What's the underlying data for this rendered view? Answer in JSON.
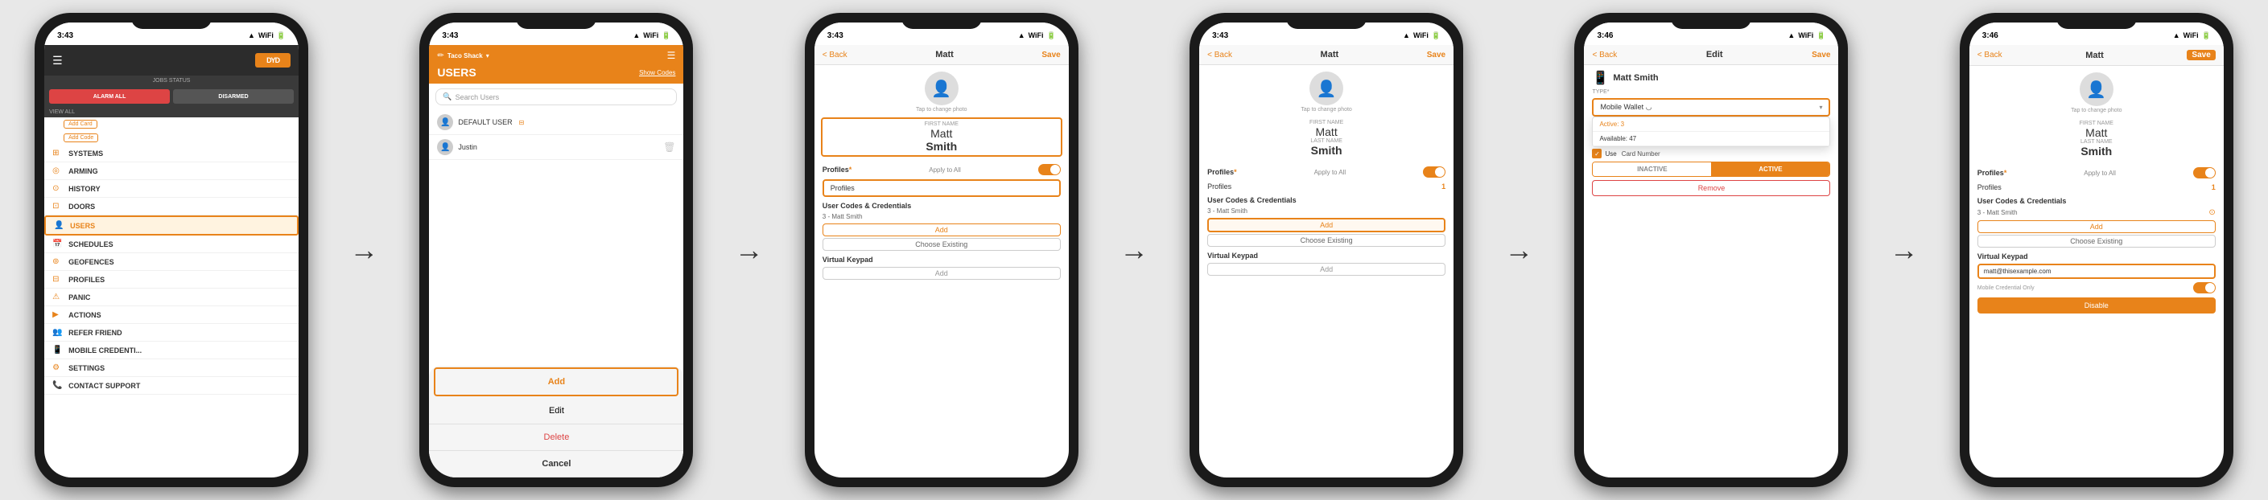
{
  "phones": [
    {
      "id": "phone1",
      "status_time": "3:43",
      "screen": "dmp_app",
      "header": {
        "logo": "DYD",
        "hamburger": "☰"
      },
      "job_status": {
        "label": "JOBS STATUS",
        "alarm_btn": "ALARM ALL",
        "disarm_btn": "DISARMED",
        "view_label": "VIEW ALL"
      },
      "sidebar_items": [
        {
          "id": "systems",
          "icon": "⊞",
          "label": "SYSTEMS"
        },
        {
          "id": "arming",
          "icon": "◎",
          "label": "ARMING"
        },
        {
          "id": "history",
          "icon": "⊙",
          "label": "HISTORY"
        },
        {
          "id": "doors",
          "icon": "⊡",
          "label": "DOORS"
        },
        {
          "id": "users",
          "icon": "👤",
          "label": "USERS",
          "active": true
        },
        {
          "id": "schedules",
          "icon": "📅",
          "label": "SCHEDULES"
        },
        {
          "id": "geofences",
          "icon": "⊚",
          "label": "GEOFENCES"
        },
        {
          "id": "profiles",
          "icon": "⊟",
          "label": "PROFILES"
        },
        {
          "id": "panic",
          "icon": "⚠",
          "label": "PANIC"
        },
        {
          "id": "actions",
          "icon": "▶",
          "label": "ACTIONS"
        },
        {
          "id": "refer",
          "icon": "👥",
          "label": "REFER FRIEND"
        },
        {
          "id": "mobile",
          "icon": "📱",
          "label": "MOBILE CREDENTI..."
        },
        {
          "id": "settings",
          "icon": "⚙",
          "label": "SETTINGS"
        },
        {
          "id": "support",
          "icon": "📞",
          "label": "CONTACT SUPPORT"
        }
      ],
      "add_card_label": "Add Card",
      "add_code_label": "Add Code"
    },
    {
      "id": "phone2",
      "status_time": "3:43",
      "screen": "users",
      "store_name": "Taco Shack",
      "store_arrow": "▾",
      "title": "USERS",
      "show_codes": "Show Codes",
      "search_placeholder": "Search Users",
      "users": [
        {
          "name": "DEFAULT USER",
          "badge": "⊟"
        },
        {
          "name": "Justin",
          "delete": true
        }
      ],
      "action_sheet": {
        "add": "Add",
        "edit": "Edit",
        "delete": "Delete",
        "cancel": "Cancel"
      }
    },
    {
      "id": "phone3",
      "status_time": "3:43",
      "screen": "edit_user",
      "nav": {
        "back": "< Back",
        "title": "Matt",
        "save": "Save"
      },
      "tap_hint": "Tap to change photo",
      "first_name_label": "FIRST NAME",
      "first_name": "Matt",
      "last_name_label": "LAST NAME",
      "last_name": "Smith",
      "profiles_label": "Profiles",
      "profiles_asterisk": "*",
      "apply_to_all": "Apply to All",
      "profiles_placeholder": "Profiles",
      "user_codes_title": "User Codes & Credentials",
      "cred_item": "3 - Matt Smith",
      "add_btn": "Add",
      "choose_existing_btn": "Choose Existing",
      "virtual_keypad_title": "Virtual Keypad",
      "vk_add_btn": "Add"
    },
    {
      "id": "phone4",
      "status_time": "3:43",
      "screen": "edit_user_2",
      "nav": {
        "back": "< Back",
        "title": "Matt",
        "save": "Save"
      },
      "tap_hint": "Tap to change photo",
      "first_name": "Matt",
      "last_name": "Smith",
      "profiles_label": "Profiles",
      "profiles_asterisk": "*",
      "apply_to_all": "Apply to All",
      "profiles_value": "1",
      "user_codes_title": "User Codes & Credentials",
      "cred_item": "3 - Matt Smith",
      "add_btn": "Add",
      "choose_existing_btn": "Choose Existing",
      "virtual_keypad_title": "Virtual Keypad",
      "vk_add_btn": "Add"
    },
    {
      "id": "phone5",
      "status_time": "3:46",
      "screen": "credential_type",
      "nav": {
        "back": "< Back",
        "title": "Edit",
        "save": "Save"
      },
      "user_name": "Matt Smith",
      "type_label": "Type*",
      "credential_type": "Mobile Wallet ◡",
      "popup": {
        "item1": "Active: 3",
        "item2": "Available: 47"
      },
      "inactive_label": "INACTIVE",
      "active_label": "ACTIVE",
      "use_label": "Use",
      "card_number_label": "Card Number",
      "remove_btn": "Remove"
    },
    {
      "id": "phone6",
      "status_time": "3:46",
      "screen": "virtual_keypad",
      "nav": {
        "back": "< Back",
        "title": "Matt",
        "save": "Save"
      },
      "tap_hint": "Tap to change photo",
      "first_name": "Matt",
      "last_name": "Smith",
      "profiles_label": "Profiles",
      "profiles_asterisk": "*",
      "apply_to_all": "Apply to All",
      "profiles_value": "1",
      "user_codes_title": "User Codes & Credentials",
      "cred_item": "3 - Matt Smith",
      "cred_icon": "⊙",
      "add_btn": "Add",
      "choose_existing_btn": "Choose Existing",
      "virtual_keypad_title": "Virtual Keypad",
      "email_placeholder": "matt@thisexample.com",
      "mobile_only_label": "Mobile Credential Only",
      "disable_btn": "Disable"
    }
  ],
  "arrows": [
    "→",
    "→",
    "→",
    "→",
    "→"
  ]
}
